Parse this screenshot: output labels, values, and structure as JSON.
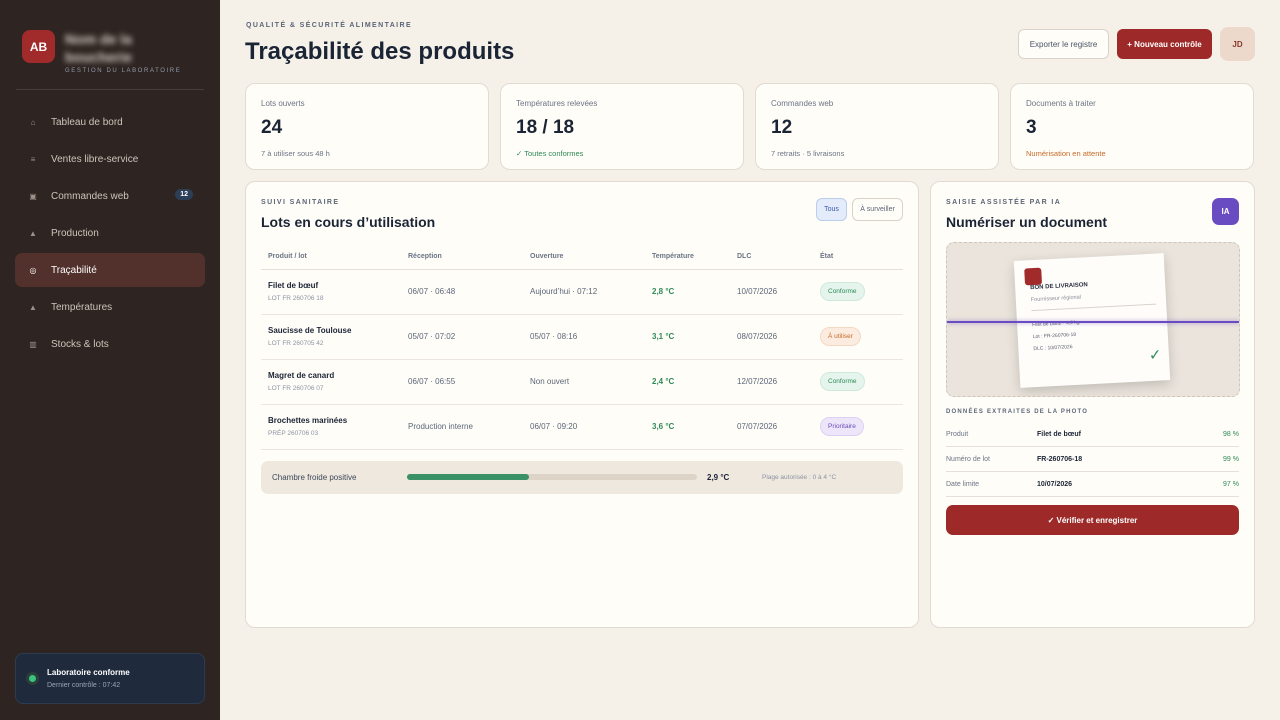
{
  "brand": {
    "initials": "AB",
    "name": "Nom de la boucherie",
    "subtitle": "GESTION DU LABORATOIRE"
  },
  "nav": [
    {
      "label": "Tableau de bord",
      "icon": "home-icon",
      "glyph": "⌂"
    },
    {
      "label": "Ventes libre-service",
      "icon": "list-icon",
      "glyph": "≡"
    },
    {
      "label": "Commandes web",
      "icon": "cart-icon",
      "glyph": "▣",
      "badge": "12"
    },
    {
      "label": "Production",
      "icon": "production-icon",
      "glyph": "▲"
    },
    {
      "label": "Traçabilité",
      "icon": "trace-icon",
      "glyph": "◎",
      "active": true
    },
    {
      "label": "Températures",
      "icon": "thermometer-icon",
      "glyph": "▲"
    },
    {
      "label": "Stocks & lots",
      "icon": "stock-icon",
      "glyph": "▥"
    }
  ],
  "status": {
    "title": "Laboratoire conforme",
    "sub": "Dernier contrôle : 07:42",
    "color": "#3ac27e"
  },
  "header": {
    "eyebrow": "QUALITÉ & SÉCURITÉ ALIMENTAIRE",
    "title": "Traçabilité des produits",
    "export_label": "Exporter le registre",
    "new_label": "+ Nouveau contrôle",
    "avatar": "JD"
  },
  "stats": [
    {
      "label": "Lots ouverts",
      "value": "24",
      "note": "7 à utiliser sous 48 h",
      "tone": ""
    },
    {
      "label": "Températures relevées",
      "value": "18 / 18",
      "note": "✓ Toutes conformes",
      "tone": "green"
    },
    {
      "label": "Commandes web",
      "value": "12",
      "note": "7 retraits · 5 livraisons",
      "tone": ""
    },
    {
      "label": "Documents à traiter",
      "value": "3",
      "note": "Numérisation en attente",
      "tone": "orange"
    }
  ],
  "lots": {
    "eyebrow": "SUIVI SANITAIRE",
    "title": "Lots en cours d’utilisation",
    "filter_all": "Tous",
    "filter_watch": "À surveiller",
    "columns": [
      "Produit / lot",
      "Réception",
      "Ouverture",
      "Température",
      "DLC",
      "État"
    ],
    "rows": [
      {
        "name": "Filet de bœuf",
        "lot": "LOT FR 260706 18",
        "reception": "06/07 · 06:48",
        "opening": "Aujourd’hui · 07:12",
        "temp": "2,8 °C",
        "dlc": "10/07/2026",
        "state": "Conforme",
        "tone": "conforme"
      },
      {
        "name": "Saucisse de Toulouse",
        "lot": "LOT FR 260705 42",
        "reception": "05/07 · 07:02",
        "opening": "05/07 · 08:16",
        "temp": "3,1 °C",
        "dlc": "08/07/2026",
        "state": "À utiliser",
        "tone": "utiliser"
      },
      {
        "name": "Magret de canard",
        "lot": "LOT FR 260706 07",
        "reception": "06/07 · 06:55",
        "opening": "Non ouvert",
        "temp": "2,4 °C",
        "dlc": "12/07/2026",
        "state": "Conforme",
        "tone": "conforme"
      },
      {
        "name": "Brochettes marinées",
        "lot": "PRÉP 260706 03",
        "reception": "Production interne",
        "opening": "06/07 · 09:20",
        "temp": "3,6 °C",
        "dlc": "07/07/2026",
        "state": "Prioritaire",
        "tone": "prioritaire"
      }
    ]
  },
  "cold_room": {
    "label": "Chambre froide positive",
    "value": "2,9 °C",
    "range": "Plage autorisée : 0 à 4 °C",
    "fill_fraction": 0.42
  },
  "scan": {
    "eyebrow": "SAISIE ASSISTÉE PAR IA",
    "title": "Numériser un document",
    "badge": "IA",
    "doc_title": "BON DE LIVRAISON",
    "doc_sub": "Fournisseur régional",
    "doc_line_1": "Filet de bœuf · 4,2 kg",
    "doc_line_2": "Lot : FR-260706-18",
    "doc_line_3": "DLC : 10/07/2026",
    "extract_title": "DONNÉES EXTRAITES DE LA PHOTO",
    "fields": [
      {
        "label": "Produit",
        "value": "Filet de bœuf",
        "confidence": "98 %"
      },
      {
        "label": "Numéro de lot",
        "value": "FR-260706-18",
        "confidence": "99 %"
      },
      {
        "label": "Date limite",
        "value": "10/07/2026",
        "confidence": "97 %"
      }
    ],
    "verify_label": "✓ Vérifier et enregistrer"
  }
}
